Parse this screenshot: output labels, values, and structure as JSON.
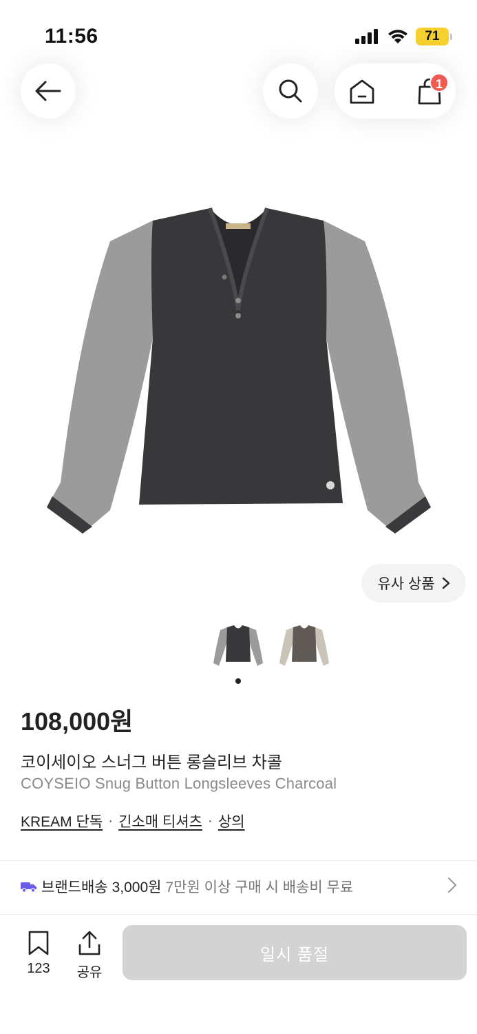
{
  "status_bar": {
    "time": "11:56",
    "battery": "71"
  },
  "header": {
    "cart_count": "1"
  },
  "product": {
    "image_logo": "COYSEIO",
    "similar_label": "유사 상품",
    "price": "108,000원",
    "name_ko": "코이세이오 스너그 버튼 롱슬리브 차콜",
    "name_en": "COYSEIO Snug Button Longsleeves Charcoal",
    "tags": [
      "KREAM 단독",
      "긴소매 티셔츠",
      "상의"
    ],
    "tag_separator": "·"
  },
  "delivery": {
    "type": "브랜드배송",
    "fee": "3,000원",
    "note": "7만원 이상 구매 시 배송비 무료",
    "icon": "truck-icon",
    "icon_color": "#6b5ce7"
  },
  "bottom_bar": {
    "bookmark_count": "123",
    "share_label": "공유",
    "action_label": "일시 품절"
  },
  "colors": {
    "badge": "#ef5b50",
    "battery": "#f6d02f",
    "body_charcoal": "#38383a",
    "sleeve_grey": "#9a9a9a"
  }
}
